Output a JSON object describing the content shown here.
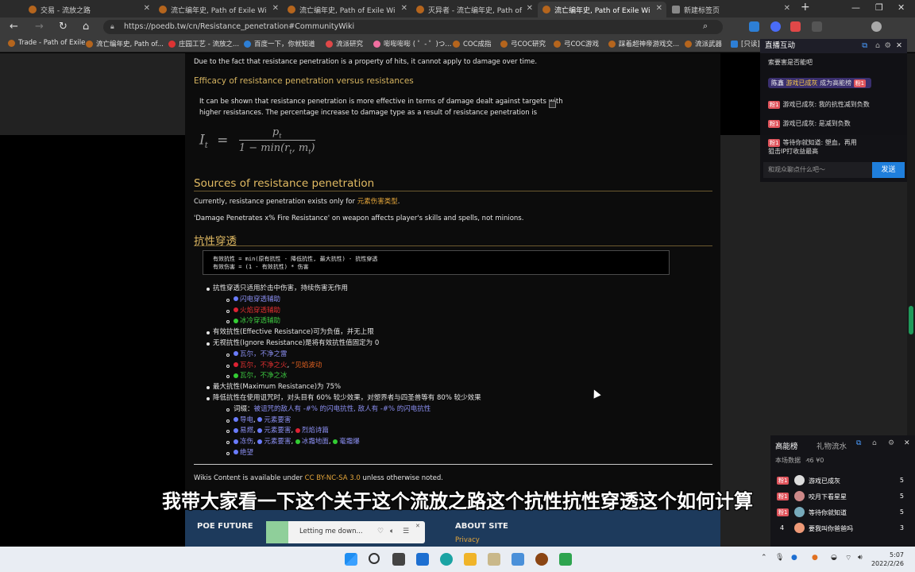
{
  "tabs": [
    {
      "title": "交易 - 流放之路",
      "active": false
    },
    {
      "title": "流亡编年史, Path of Exile Wiki",
      "active": false
    },
    {
      "title": "流亡编年史, Path of Exile Wiki",
      "active": false
    },
    {
      "title": "灭异者 - 流亡编年史, Path of Exile",
      "active": false
    },
    {
      "title": "流亡编年史, Path of Exile Wiki",
      "active": true
    },
    {
      "title": "新建标签页",
      "active": false
    }
  ],
  "url": "https://poedb.tw/cn/Resistance_penetration#CommunityWiki",
  "bookmarks": [
    "Trade - Path of Exile",
    "流亡编年史, Path of...",
    "庄园工艺 - 流放之...",
    "百度一下，你就知道",
    "流派研究",
    "嘭嘭嘭嘭 ( ゜- ゜)つ...",
    "COC成指",
    "弓COC研究",
    "弓COC游戏",
    "踩着超神帝游戏交...",
    "流派武器",
    "[只读]"
  ],
  "article": {
    "intro": "Due to the fact that resistance penetration is a property of hits, it cannot apply to damage over time.",
    "h_efficacy": "Efficacy of resistance penetration versus resistances",
    "efficacy_line1": "It can be shown that resistance penetration is more effective in terms of damage dealt against targets with",
    "efficacy_line2": "higher resistances. The percentage increase to damage type  as a result of resistance penetration is",
    "f_lhs": "I",
    "f_sub": "t",
    "f_eq": "=",
    "f_num": "p",
    "f_den": "1 − min(r",
    "f_den_tail": ", m",
    "f_den_end": ")",
    "h_sources": "Sources of resistance penetration",
    "sources_pre": "Currently, resistance penetration exists only for ",
    "sources_link1": "元素",
    "sources_link2": "伤害类型",
    "sources_post": ".",
    "weapon_note": "'Damage Penetrates x% Fire Resistance' on weapon affects player's skills and spells, not minions.",
    "h_cn": "抗性穿透",
    "code1": "有效抗性 = min(原有抗性 - 降低抗性, 最大抗性) - 抗性穿透",
    "code2": "有效伤害 = (1 - 有效抗性) * 伤害",
    "li1": "抗性穿透只适用於击中伤害，持续伤害无作用",
    "li1_sub": [
      "闪电穿透辅助",
      "火焰穿透辅助",
      "冰冷穿透辅助"
    ],
    "li2": "有效抗性(Effective Resistance)可为负值，并无上限",
    "li3": "无视抗性(Ignore Resistance)是将有效抗性值固定为 0",
    "li3_sub1": "瓦尔，不净之雷",
    "li3_sub2a": "瓦尔，不净之火",
    "li3_sub2b": "“见焰波动",
    "li3_sub3": "瓦尔，不净之冰",
    "li4": "最大抗性(Maximum Resistance)为 75%",
    "li5": "降低抗性在使用诅咒时，对头目有 60% 较少效果，对塑界者与四圣兽等有 80% 较少效果",
    "li5_sub1_pre": "词缀：",
    "li5_sub1_link": "被诅咒的敌人有 -#% 的闪电抗性, 敌人有 -#% 的闪电抗性",
    "li5_sub2": [
      "导电",
      "元素要害"
    ],
    "li5_sub3": [
      "易燃",
      "元素要害",
      "烈焰诗篇"
    ],
    "li5_sub4": [
      "冻伤",
      "元素要害",
      "冰霜地面",
      "毫霜爆"
    ],
    "li5_sub5": [
      "绝望"
    ],
    "license_pre": "Wikis Content is available under ",
    "license_link": "CC BY-NC-SA 3.0",
    "license_post": " unless otherwise noted."
  },
  "footer": {
    "left_title": "POE FUTURE",
    "player_text": "Letting me down...",
    "right_title": "ABOUT SITE",
    "privacy": "Privacy"
  },
  "subtitle": "我带大家看一下这个关于这个流放之路这个抗性抗性穿透这个如何计算",
  "live": {
    "title": "直播互动",
    "msg0": "索要害是否能吧",
    "msg1_name": "陈鑫",
    "msg1_badge": "游戏已成灰",
    "msg1_text": "成为高能榜",
    "msg2": "游戏已成灰: 我的抗性减到负数",
    "msg3": "游戏已成灰: 是减到负数",
    "msg4_name": "等待你就知道",
    "msg4_text": "等待你就知道: 塑血，再用",
    "msg4_text2": "狙击IP打收益最高",
    "input_placeholder": "和观众聊点什么吧～",
    "send": "发送",
    "badge_lv": "粉1"
  },
  "rank": {
    "tab1": "高能榜",
    "tab2": "礼物流水",
    "stats": "本场数据",
    "people": "6",
    "money": "¥0",
    "rows": [
      {
        "rank": "1",
        "name": "游戏已成灰",
        "score": "5"
      },
      {
        "rank": "2",
        "name": "咬月下看星星",
        "score": "5"
      },
      {
        "rank": "3",
        "name": "等待你就知道",
        "score": "5"
      },
      {
        "rank": "4",
        "name": "要我叫你爸爸吗",
        "score": "3"
      }
    ]
  },
  "clock": {
    "time": "5:07",
    "date": "2022/2/26"
  },
  "colors": {
    "gold": "#e2bb63",
    "link_blue": "#8a8ef0",
    "send_blue": "#1f7fdc",
    "footer_blue": "#1d3a5c"
  }
}
